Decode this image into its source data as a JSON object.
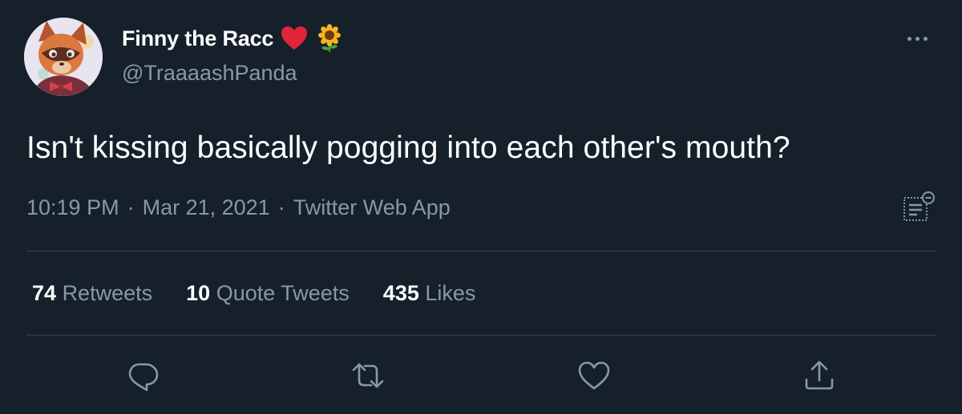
{
  "user": {
    "display_name": "Finny the Racc",
    "handle": "@TraaaashPanda",
    "avatar_icon": "raccoon-avatar",
    "name_emojis": [
      "red-heart-icon",
      "sunflower-icon"
    ]
  },
  "tweet": {
    "text": "Isn't kissing basically pogging into each other's mouth?",
    "time": "10:19 PM",
    "separator": "·",
    "date": "Mar 21, 2021",
    "source": "Twitter Web App"
  },
  "stats": {
    "retweets": {
      "count": "74",
      "label": "Retweets"
    },
    "quotes": {
      "count": "10",
      "label": "Quote Tweets"
    },
    "likes": {
      "count": "435",
      "label": "Likes"
    }
  },
  "actions": [
    "reply-icon",
    "retweet-icon",
    "like-icon",
    "share-icon"
  ],
  "colors": {
    "background": "#15202b",
    "text": "#ffffff",
    "secondary": "#8899a6",
    "divider": "#38444d",
    "heart": "#e0243a"
  }
}
